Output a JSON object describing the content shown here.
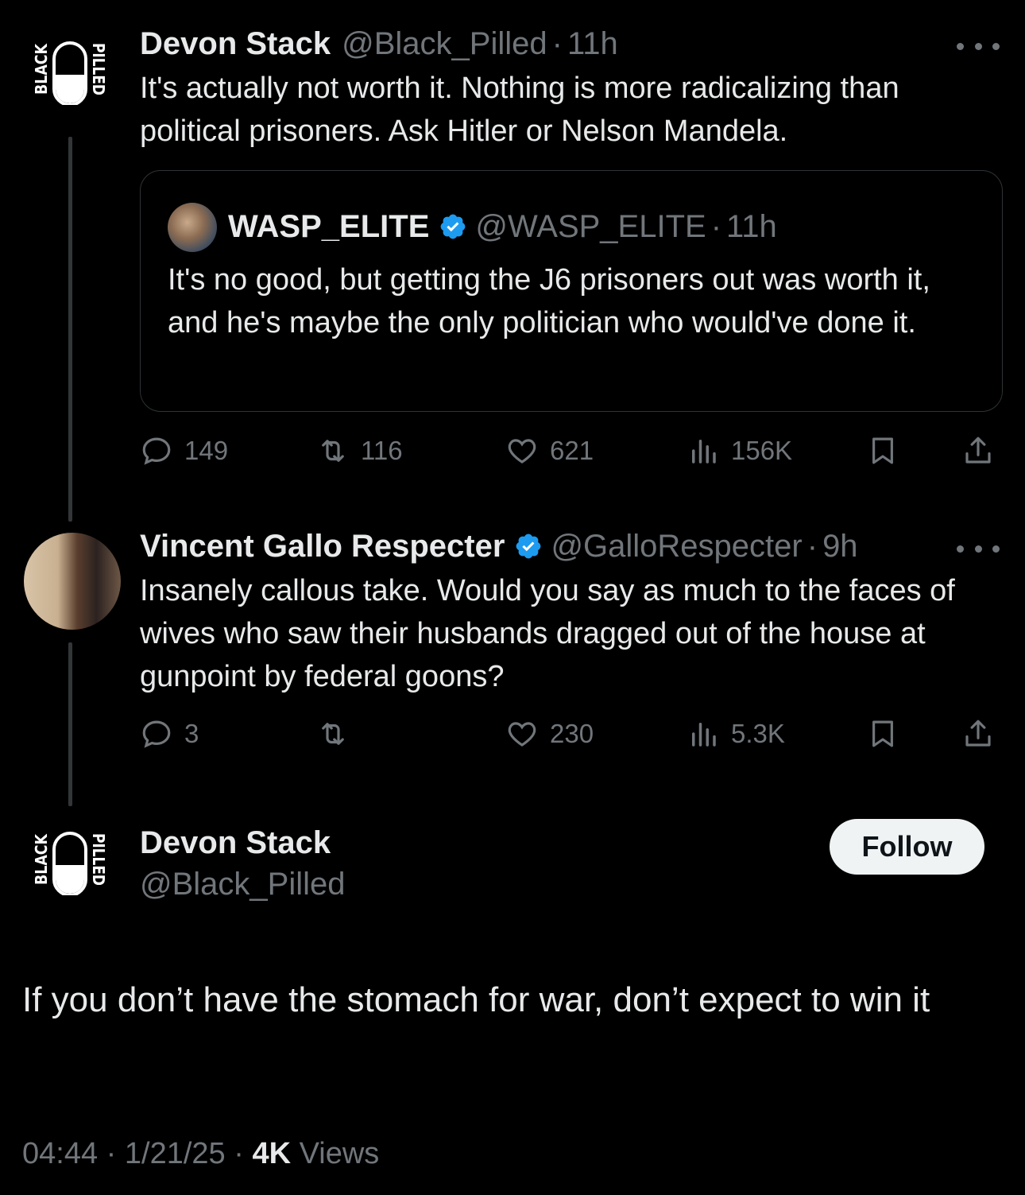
{
  "logo_text": {
    "top": "BLACK",
    "bottom": "PILLED"
  },
  "tweet1": {
    "name": "Devon Stack",
    "handle": "@Black_Pilled",
    "sep": "·",
    "time": "11h",
    "text": "It's actually not worth it. Nothing is more radicalizing than political prisoners. Ask Hitler or Nelson Mandela.",
    "quote": {
      "name": "WASP_ELITE",
      "handle": "@WASP_ELITE",
      "sep": "·",
      "time": "11h",
      "text": "It's no good, but getting the J6 prisoners out was worth it, and he's maybe the only politician who would've done it."
    },
    "stats": {
      "replies": "149",
      "retweets": "116",
      "likes": "621",
      "views": "156K"
    }
  },
  "tweet2": {
    "name": "Vincent Gallo Respecter",
    "handle": "@GalloRespecter",
    "sep": "·",
    "time": "9h",
    "text": "Insanely callous take. Would you say as much to the faces of wives who saw their husbands dragged out of the house at gunpoint by federal goons?",
    "stats": {
      "replies": "3",
      "retweets": "",
      "likes": "230",
      "views": "5.3K"
    }
  },
  "main_tweet": {
    "name": "Devon Stack",
    "handle": "@Black_Pilled",
    "follow_label": "Follow",
    "text": "If you don’t have the stomach for war, don’t expect to win it",
    "time": "04:44",
    "date": "1/21/25",
    "views_count": "4K",
    "views_label": "Views",
    "sep": "·"
  },
  "colors": {
    "background": "#000000",
    "text": "#e7e9ea",
    "muted": "#71767b",
    "verified": "#1d9bf0",
    "border": "#2f3336"
  }
}
